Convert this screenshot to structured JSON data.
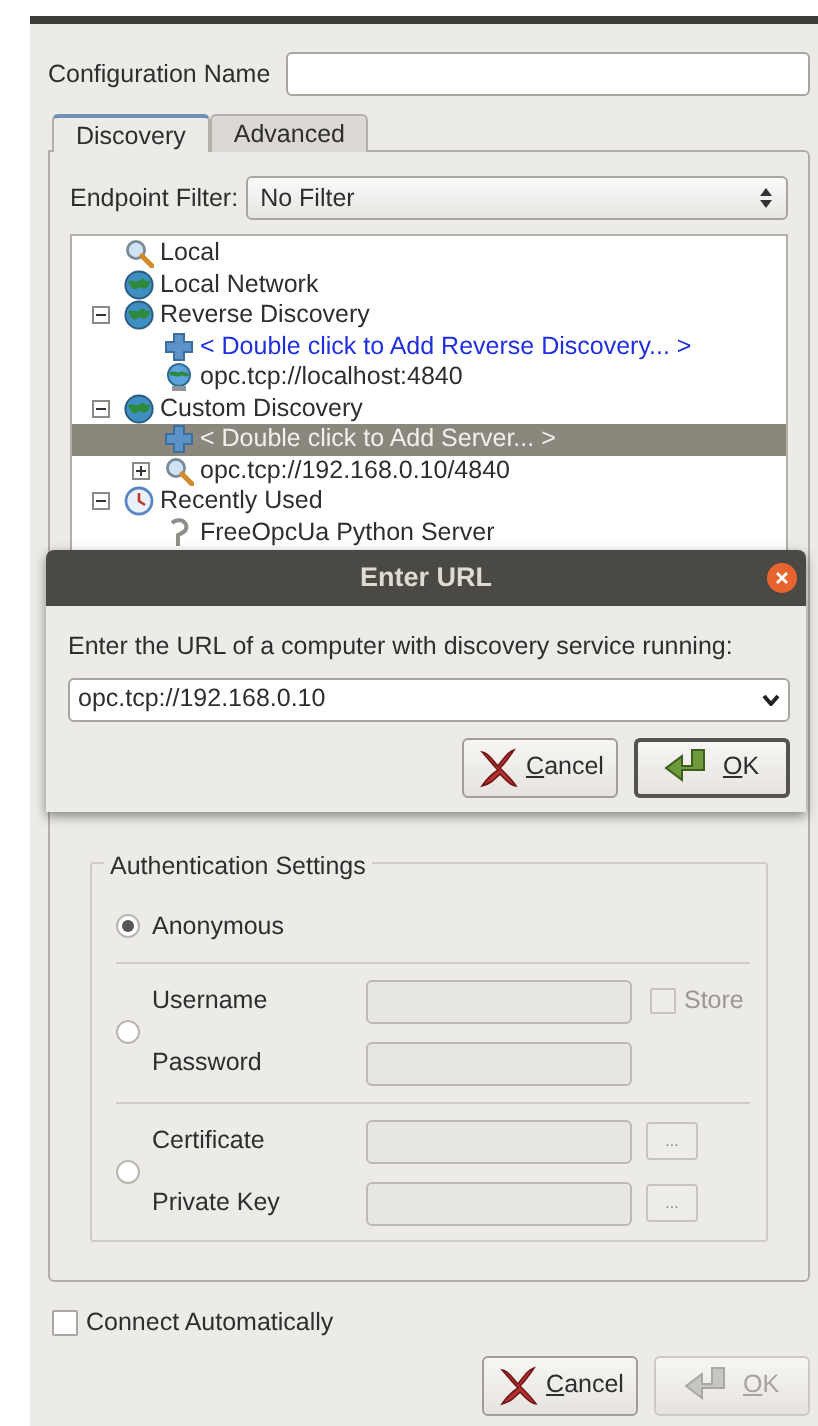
{
  "config_name": {
    "label": "Configuration Name"
  },
  "tabs": [
    {
      "label": "Discovery",
      "selected": true
    },
    {
      "label": "Advanced",
      "selected": false
    }
  ],
  "endpoint_filter": {
    "label": "Endpoint Filter:",
    "value": "No Filter"
  },
  "tree": [
    {
      "label": "Local",
      "kind": "search",
      "selected": false
    },
    {
      "label": "Local Network",
      "kind": "globe",
      "selected": false
    },
    {
      "label": "Reverse Discovery",
      "kind": "globe",
      "selected": false,
      "expanded": true,
      "children": [
        {
          "label": "< Double click to Add Reverse Discovery... >",
          "kind": "add",
          "selected": false
        },
        {
          "label": "opc.tcp://localhost:4840",
          "kind": "server",
          "selected": false
        }
      ]
    },
    {
      "label": "Custom Discovery",
      "kind": "globe",
      "selected": false,
      "expanded": true,
      "children": [
        {
          "label": "< Double click to Add Server... >",
          "kind": "add",
          "selected": true
        },
        {
          "label": "opc.tcp://192.168.0.10/4840",
          "kind": "search",
          "selected": false,
          "expanded": false
        }
      ]
    },
    {
      "label": "Recently Used",
      "kind": "clock",
      "selected": false,
      "expanded": true,
      "children": [
        {
          "label": "FreeOpcUa Python Server",
          "kind": "recent",
          "selected": false
        }
      ]
    }
  ],
  "auth": {
    "title": "Authentication Settings",
    "options": [
      {
        "selected": true,
        "fields": [
          {
            "kind": "radio-label",
            "label": "Anonymous"
          }
        ]
      },
      {
        "selected": false,
        "fields": [
          {
            "kind": "entry",
            "label": "Username",
            "store": {
              "label": "Store",
              "checked": false
            }
          },
          {
            "kind": "entry",
            "label": "Password"
          }
        ]
      },
      {
        "selected": false,
        "fields": [
          {
            "kind": "entry",
            "label": "Certificate",
            "browse": "..."
          },
          {
            "kind": "entry",
            "label": "Private Key",
            "browse": "..."
          }
        ]
      }
    ]
  },
  "connect_automatically": {
    "label": "Connect Automatically",
    "checked": false
  },
  "buttons": [
    {
      "label": "Cancel",
      "kind": "cancel",
      "mnemonic": true,
      "disabled": false,
      "default": false
    },
    {
      "label": "OK",
      "kind": "ok",
      "mnemonic": true,
      "disabled": true,
      "default": false
    }
  ],
  "dialog": {
    "title": "Enter URL",
    "prompt": "Enter the URL of a computer with discovery service running:",
    "value": "opc.tcp://192.168.0.10",
    "buttons": [
      {
        "label": "Cancel",
        "kind": "cancel",
        "mnemonic": true,
        "disabled": false,
        "default": false
      },
      {
        "label": "OK",
        "kind": "ok",
        "mnemonic": true,
        "disabled": false,
        "default": true
      }
    ]
  }
}
